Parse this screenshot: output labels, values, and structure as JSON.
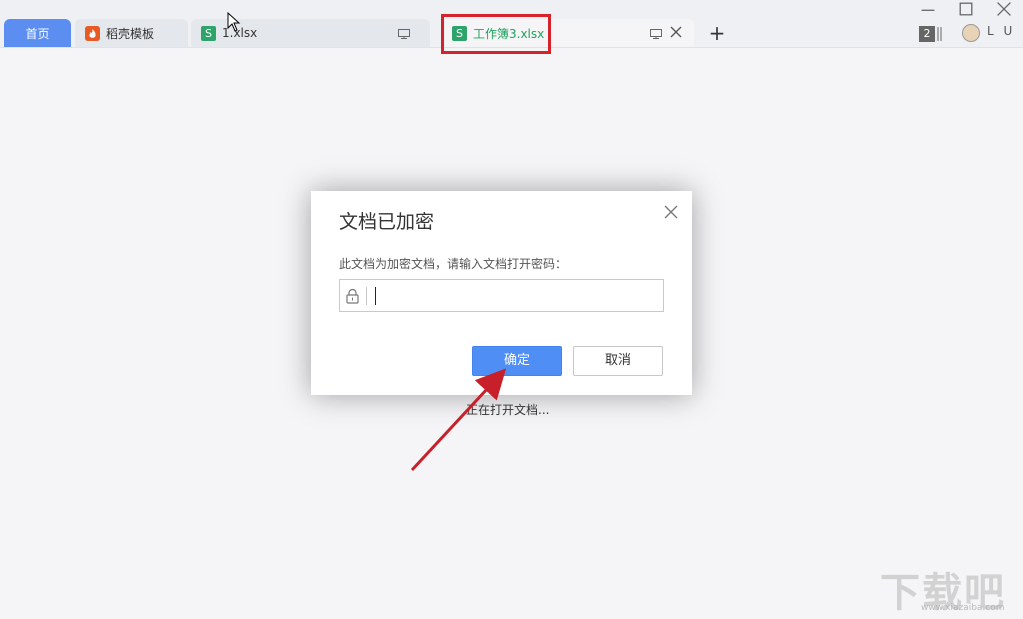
{
  "tabs": {
    "home": "首页",
    "daoke": "稻壳模板",
    "file1": "1.xlsx",
    "active": "工作簿3.xlsx",
    "file_icon_letter": "S",
    "new_tab": "+"
  },
  "header": {
    "window_count": "2",
    "user_name": "L U"
  },
  "dialog": {
    "title": "文档已加密",
    "message": "此文档为加密文档，请输入文档打开密码：",
    "password_value": "",
    "ok_label": "确定",
    "cancel_label": "取消"
  },
  "status": {
    "text": "正在打开文档..."
  },
  "watermark": {
    "text": "下载吧",
    "sub": "www.xiazaiba.com"
  },
  "colors": {
    "accent": "#4f8ff5",
    "sheet_green": "#2ea36a",
    "highlight_red": "#d4232a"
  }
}
